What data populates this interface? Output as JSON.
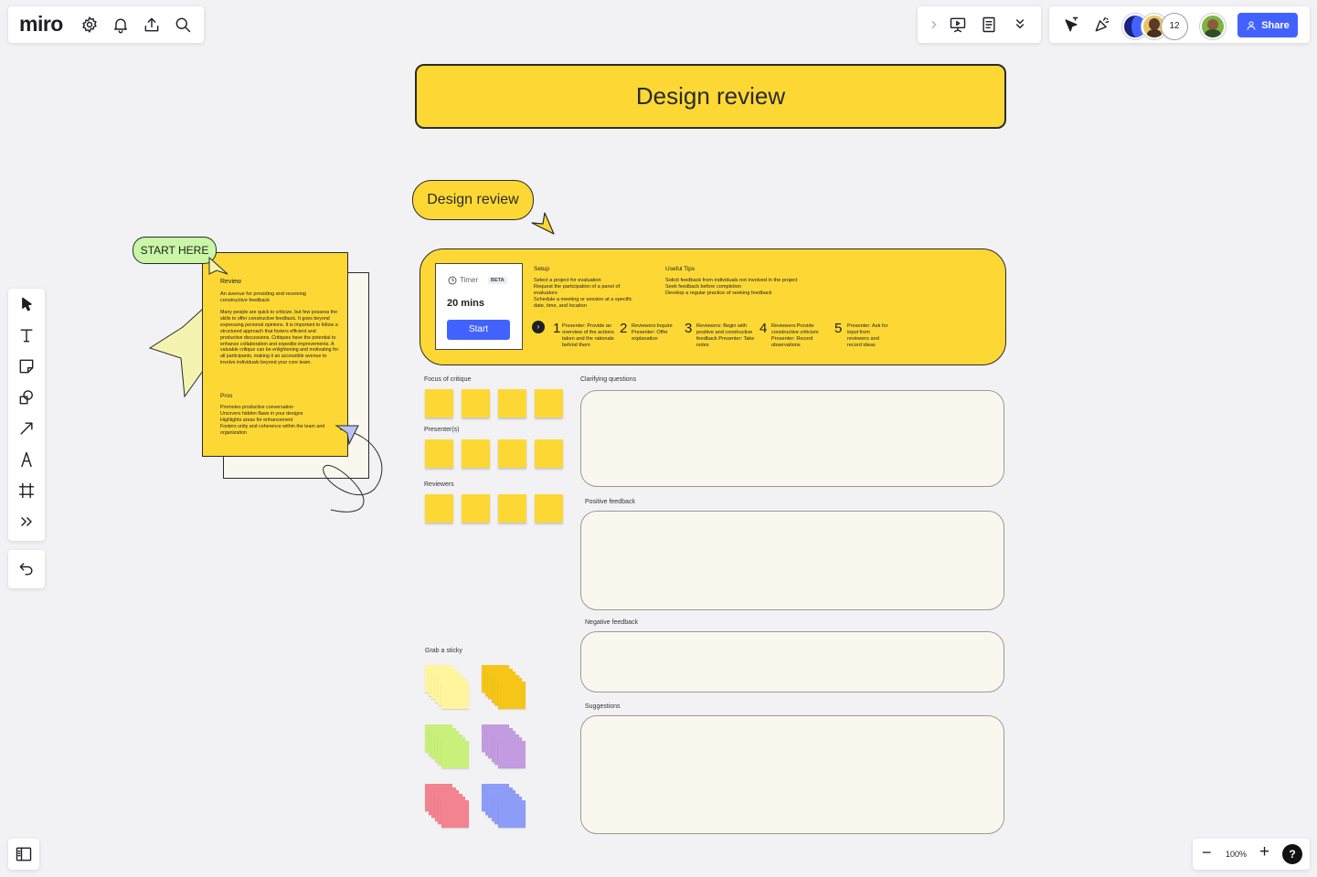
{
  "app": {
    "logo": "miro"
  },
  "topbar_left": {
    "icons": [
      "gear-icon",
      "bell-icon",
      "upload-icon",
      "search-icon"
    ]
  },
  "topbar_center": {
    "icons": [
      "chevron-right-icon",
      "presentation-icon",
      "notes-icon",
      "double-chevron-down-icon"
    ]
  },
  "topbar_right": {
    "collaborators_count": "12",
    "share_label": "Share"
  },
  "left_toolbar": {
    "tools": [
      "select",
      "text",
      "sticky-note",
      "shapes",
      "connector-line",
      "pen",
      "frame",
      "more-tools"
    ],
    "undo": "undo"
  },
  "zoom": {
    "level": "100%",
    "minus": "−",
    "plus": "+",
    "help": "?"
  },
  "canvas": {
    "main_title": "Design review",
    "small_title": "Design review",
    "start_here": "START HERE",
    "intro_card": {
      "review_heading": "Review",
      "review_lead": "An avenue for providing and receiving constructive feedback",
      "review_body": "Many people are quick to criticize, but few possess the skills to offer constructive feedback. It goes beyond expressing personal opinions. It is important to follow a structured approach that fosters efficient and productive discussions. Critiques have the potential to enhance collaboration and expedite improvements. A valuable critique can be enlightening and motivating for all participants, making it an accessible avenue to involve individuals beyond your core team.",
      "pros_heading": "Pros",
      "pros_body": "Promotes productive conversation\nUncovers hidden flaws in your designs\nHighlights areas for enhancement\nFosters unity and coherence within the team and organization"
    },
    "timer": {
      "label": "Timer",
      "badge": "BETA",
      "duration": "20 mins",
      "start_label": "Start"
    },
    "setup": {
      "heading": "Setup",
      "body": "Select a project for evaluation\nRequest the participation of a panel of evaluators\nSchedule a meeting or session at a specific date, time, and location"
    },
    "tips": {
      "heading": "Useful Tips",
      "body": "Solicit feedback from individuals not involved in the project\nSeek feedback before completion\nDevelop a regular practice of seeking feedback"
    },
    "steps": [
      {
        "num": "1",
        "text": "Presenter: Provide an overview of the actions taken and the rationale behind them"
      },
      {
        "num": "2",
        "text": "Reviewers:Inquire Presenter: Offer explanation"
      },
      {
        "num": "3",
        "text": "Reviewers: Begin with positive and constructive feedback Presenter: Take notes"
      },
      {
        "num": "4",
        "text": "Reviewers:Provide constructive criticism Presenter: Record observations"
      },
      {
        "num": "5",
        "text": "Presenter: Ask for input from reviewers and record ideas"
      }
    ],
    "sections": {
      "focus": "Focus of critique",
      "presenters": "Presenter(s)",
      "reviewers": "Reviewers",
      "clarifying": "Clarifying questions",
      "positive": "Positive feedback",
      "negative": "Negative feedback",
      "suggestions": "Suggestions",
      "grab": "Grab a sticky"
    },
    "sticky_colors": {
      "yellow": "#fdd835",
      "light_yellow": "#fff59d",
      "gold": "#f5c518",
      "light_green": "#c8f07a",
      "lavender": "#c39be0",
      "pink": "#f2838f",
      "periwinkle": "#8d9cf6"
    }
  },
  "colors": {
    "accent_blue": "#4262ff",
    "canvas_bg": "#f2f2f4",
    "title_yellow": "#fdd835"
  }
}
